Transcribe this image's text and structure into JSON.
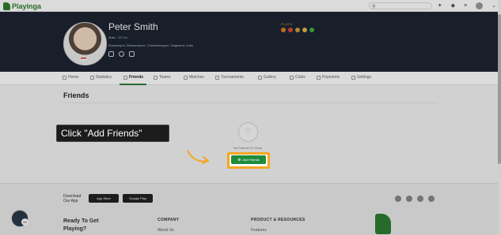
{
  "app": {
    "name": "Playinga"
  },
  "profile": {
    "name": "Peter Smith",
    "meta": "Male · 22 Yrs",
    "address": "Bhawanipur, Bhawanipore, Chandernagore, Nagaland, India",
    "plays_label": "PLAYS"
  },
  "tabs": [
    {
      "label": "Home"
    },
    {
      "label": "Statistics"
    },
    {
      "label": "Friends"
    },
    {
      "label": "Teams"
    },
    {
      "label": "Matches"
    },
    {
      "label": "Tournaments"
    },
    {
      "label": "Gallery"
    },
    {
      "label": "Clubs"
    },
    {
      "label": "Payments"
    },
    {
      "label": "Settings"
    }
  ],
  "friends": {
    "title": "Friends",
    "empty_text": "No Friends To Show",
    "add_button": "Add Friends"
  },
  "tooltip": {
    "text": "Click \"Add Friends\""
  },
  "footer": {
    "download": "Download Our App",
    "app_store": "App Store",
    "google_play": "Google Play",
    "ready": "Ready To Get Playing?",
    "company_head": "COMPANY",
    "company_link": "About Us",
    "product_head": "PRODUCT & RESOURCES",
    "product_link": "Features"
  },
  "chat_badge": "94",
  "colors": {
    "accent": "#1e8c3c",
    "highlight": "#f5a623",
    "hero": "#1c2531"
  }
}
